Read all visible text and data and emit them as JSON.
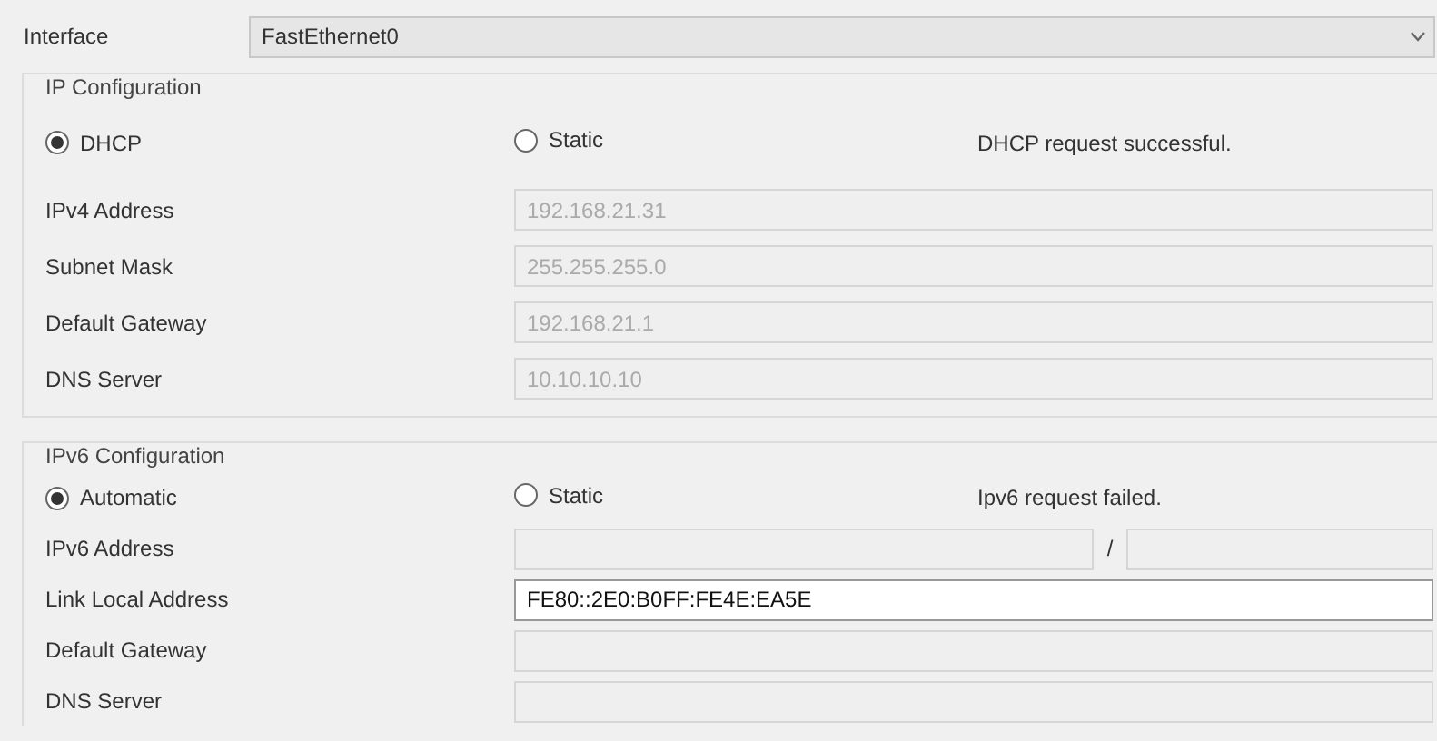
{
  "interface": {
    "label": "Interface",
    "value": "FastEthernet0"
  },
  "sections": [
    {
      "title": "IP Configuration",
      "options": [
        {
          "label": "DHCP",
          "selected": true
        },
        {
          "label": "Static",
          "selected": false
        }
      ],
      "status": "DHCP request successful.",
      "fields": [
        {
          "label": "IPv4 Address",
          "value": "192.168.21.31",
          "disabled": true
        },
        {
          "label": "Subnet Mask",
          "value": "255.255.255.0",
          "disabled": true
        },
        {
          "label": "Default Gateway",
          "value": "192.168.21.1",
          "disabled": true
        },
        {
          "label": "DNS Server",
          "value": "10.10.10.10",
          "disabled": true
        }
      ]
    },
    {
      "title": "IPv6 Configuration",
      "options": [
        {
          "label": "Automatic",
          "selected": true
        },
        {
          "label": "Static",
          "selected": false
        }
      ],
      "status": "Ipv6 request failed.",
      "fields": [
        {
          "label": "IPv6 Address",
          "kind": "prefix",
          "separator": "/",
          "disabled": true
        },
        {
          "label": "Link Local Address",
          "value": "FE80::2E0:B0FF:FE4E:EA5E",
          "disabled": false
        },
        {
          "label": "Default Gateway",
          "disabled": true
        },
        {
          "label": "DNS Server",
          "disabled": true
        }
      ]
    }
  ]
}
